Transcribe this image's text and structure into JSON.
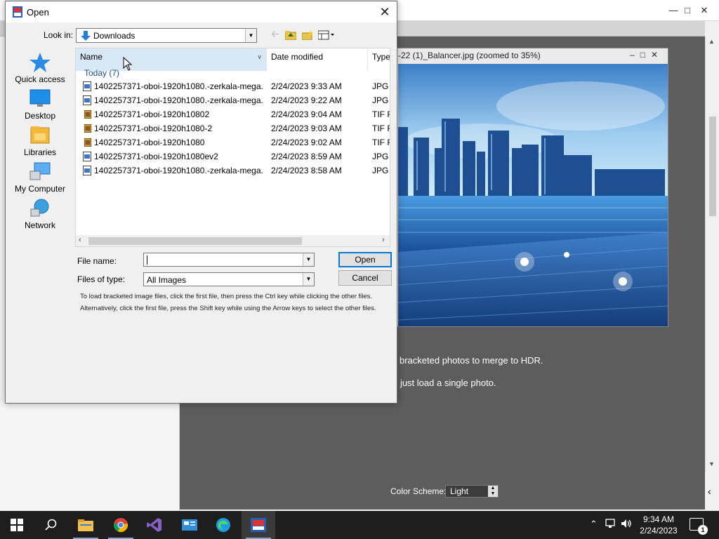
{
  "colors": {
    "accent": "#0078d7",
    "dark_canvas": "#5d5d5d",
    "taskbar": "#1e1e1e",
    "selected_header": "#d9e8f6"
  },
  "background_app": {
    "image_window_title": "-22 (1)_Balancer.jpg (zoomed to 35%)",
    "instruction_1": "bracketed photos to merge to HDR.",
    "instruction_2": "r just load a single photo.",
    "color_scheme_label": "Color Scheme:",
    "color_scheme_value": "Light"
  },
  "dialog": {
    "title": "Open",
    "look_in_label": "Look in:",
    "look_in_value": "Downloads",
    "places": [
      {
        "label": "Quick access",
        "icon": "star-icon"
      },
      {
        "label": "Desktop",
        "icon": "desktop-icon"
      },
      {
        "label": "Libraries",
        "icon": "libraries-icon"
      },
      {
        "label": "My Computer",
        "icon": "computer-icon"
      },
      {
        "label": "Network",
        "icon": "network-icon"
      }
    ],
    "columns": {
      "name": "Name",
      "date": "Date modified",
      "type": "Type"
    },
    "group_label": "Today (7)",
    "files": [
      {
        "name": "1402257371-oboi-1920h1080.-zerkala-mega...",
        "date": "2/24/2023 9:33 AM",
        "type": "JPG F",
        "icon": "jpg-file-icon"
      },
      {
        "name": "1402257371-oboi-1920h1080.-zerkala-mega...",
        "date": "2/24/2023 9:22 AM",
        "type": "JPG F",
        "icon": "jpg-file-icon"
      },
      {
        "name": "1402257371-oboi-1920h10802",
        "date": "2/24/2023 9:04 AM",
        "type": "TIF Fi",
        "icon": "tif-file-icon"
      },
      {
        "name": "1402257371-oboi-1920h1080-2",
        "date": "2/24/2023 9:03 AM",
        "type": "TIF Fi",
        "icon": "tif-file-icon"
      },
      {
        "name": "1402257371-oboi-1920h1080",
        "date": "2/24/2023 9:02 AM",
        "type": "TIF Fi",
        "icon": "tif-file-icon"
      },
      {
        "name": "1402257371-oboi-1920h1080ev2",
        "date": "2/24/2023 8:59 AM",
        "type": "JPG F",
        "icon": "jpg-file-icon"
      },
      {
        "name": "1402257371-oboi-1920h1080.-zerkala-mega...",
        "date": "2/24/2023 8:58 AM",
        "type": "JPG F",
        "icon": "jpg-file-icon"
      }
    ],
    "file_name_label": "File name:",
    "file_name_value": "",
    "files_of_type_label": "Files of type:",
    "files_of_type_value": "All Images",
    "open_button": "Open",
    "cancel_button": "Cancel",
    "hint_line_1": "To load bracketed image files, click the first file, then press the Ctrl key while clicking the other files.",
    "hint_line_2": "Alternatively, click the first file, press the Shift key while using the Arrow keys to select the other files."
  },
  "taskbar": {
    "time": "9:34 AM",
    "date": "2/24/2023",
    "notification_count": "1",
    "apps": [
      "start-icon",
      "search-icon",
      "file-explorer-icon",
      "chrome-icon",
      "visual-studio-icon",
      "app-icon",
      "edge-icon",
      "hdr-app-icon"
    ]
  }
}
